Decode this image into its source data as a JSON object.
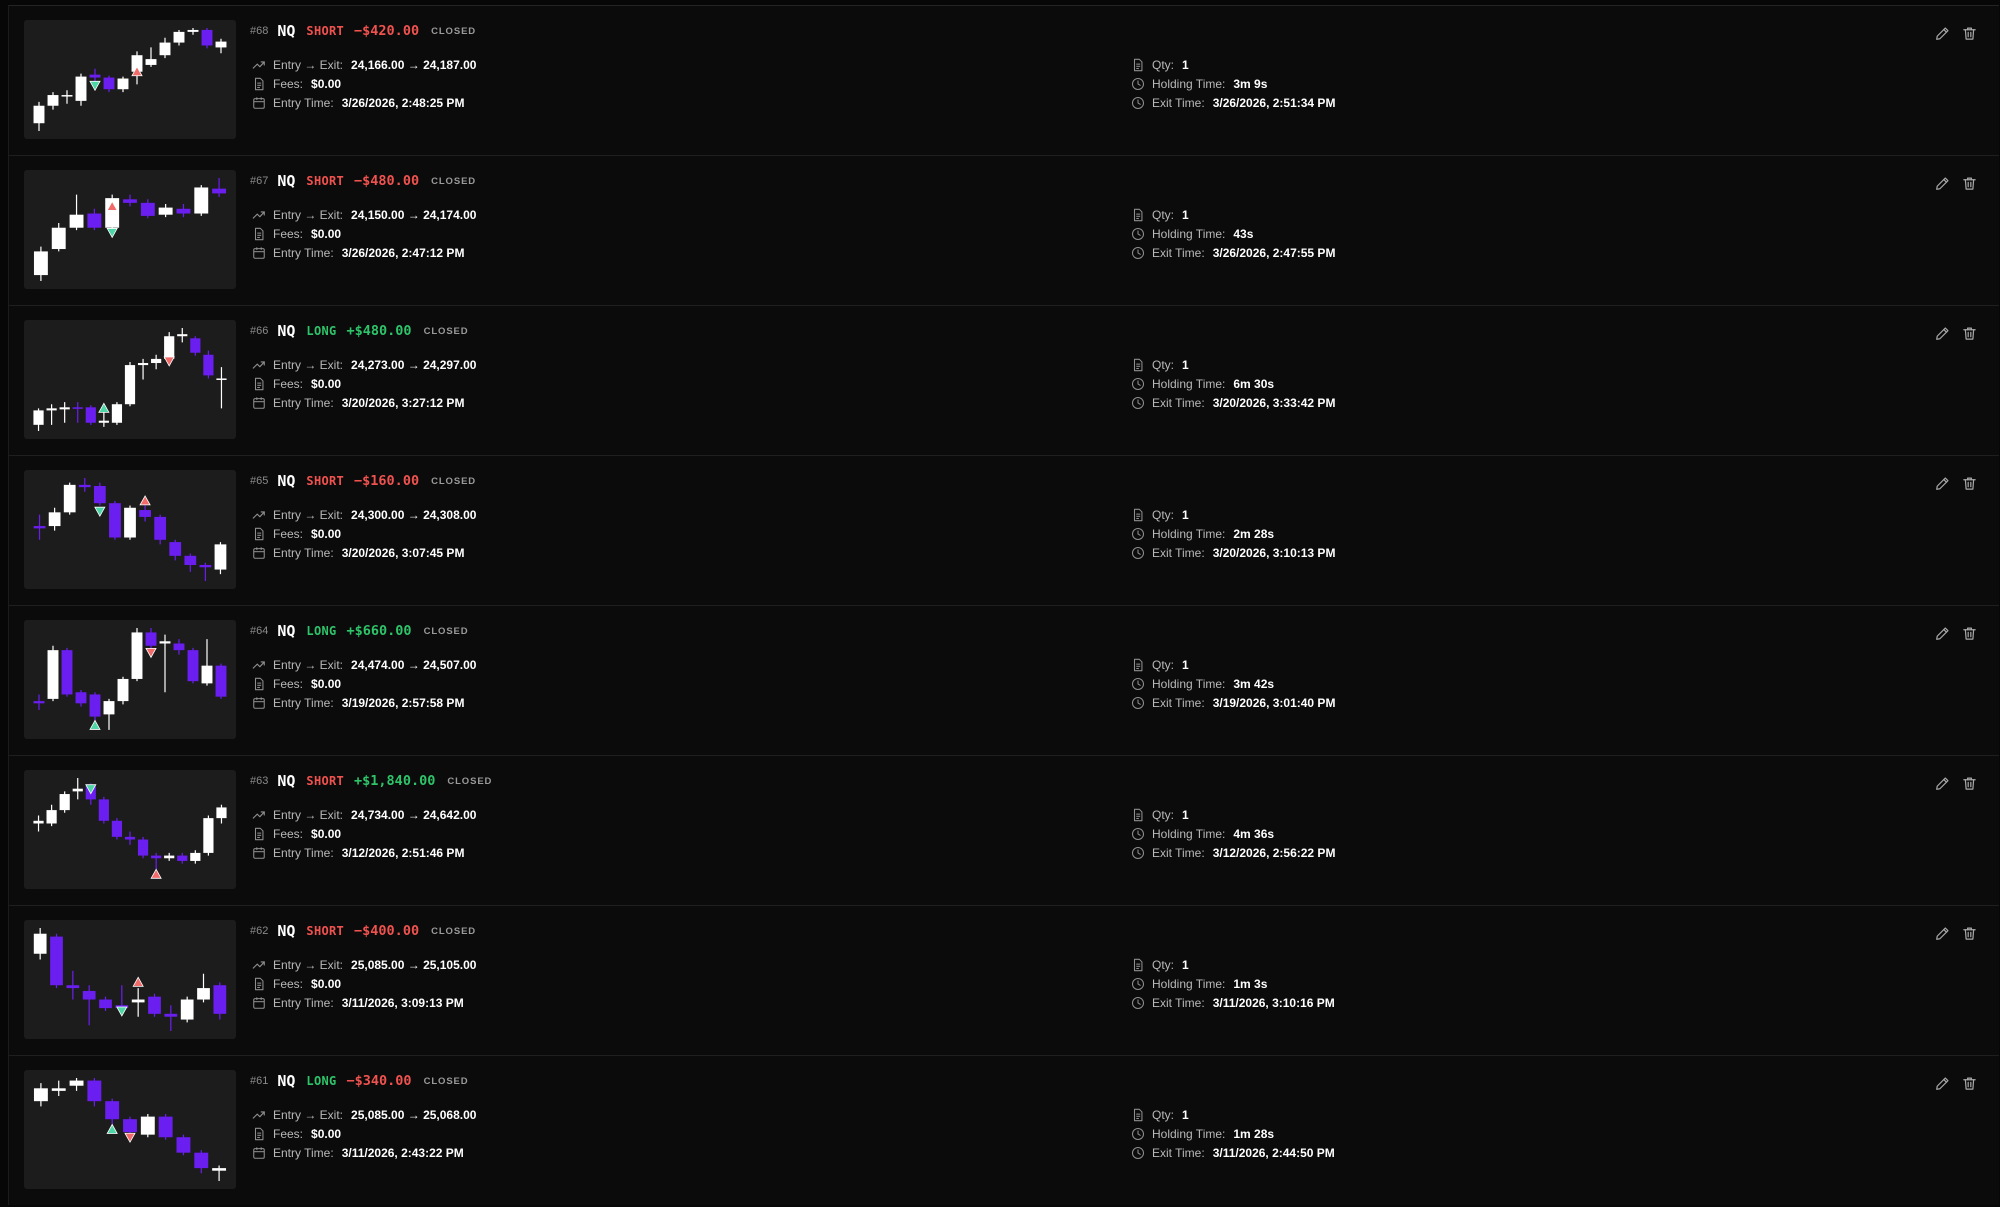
{
  "labels": {
    "entry_exit": "Entry → Exit:",
    "fees": "Fees:",
    "entry_time": "Entry Time:",
    "qty": "Qty:",
    "holding_time": "Holding Time:",
    "exit_time": "Exit Time:"
  },
  "colors": {
    "long": "#2ec46a",
    "short": "#f0524f",
    "profit": "#2ec46a",
    "loss": "#f0524f",
    "bear_candle": "#6b1ef0",
    "bull_candle": "#ffffff",
    "buy_marker": "#4fd6a6",
    "sell_marker": "#f26b6b"
  },
  "icons": {
    "entry_exit": "trending-up-icon",
    "fees": "receipt-icon",
    "entry_time": "calendar-icon",
    "qty": "document-icon",
    "holding_time": "clock-icon",
    "exit_time": "clock-icon",
    "edit": "pencil-icon",
    "delete": "trash-icon"
  },
  "trades": [
    {
      "id": "#68",
      "symbol": "NQ",
      "side": "SHORT",
      "pnl": "−$420.00",
      "pnl_sign": "loss",
      "status": "CLOSED",
      "entry_exit": "24,166.00 → 24,187.00",
      "fees": "$0.00",
      "entry_time": "3/26/2026, 2:48:25 PM",
      "qty": "1",
      "holding_time": "3m 9s",
      "exit_time": "3/26/2026, 2:51:34 PM",
      "chart": {
        "candles": [
          {
            "o": 1.2,
            "c": 3.0,
            "h": 3.4,
            "l": 0.4
          },
          {
            "o": 3.0,
            "c": 4.1,
            "h": 4.4,
            "l": 2.6
          },
          {
            "o": 4.0,
            "c": 4.1,
            "h": 4.6,
            "l": 3.2
          },
          {
            "o": 3.5,
            "c": 6.0,
            "h": 6.3,
            "l": 3.0
          },
          {
            "o": 6.2,
            "c": 5.9,
            "h": 6.8,
            "l": 5.3
          },
          {
            "o": 5.9,
            "c": 4.7,
            "h": 6.1,
            "l": 4.4
          },
          {
            "o": 4.7,
            "c": 5.8,
            "h": 6.0,
            "l": 4.4
          },
          {
            "o": 6.5,
            "c": 8.2,
            "h": 8.6,
            "l": 5.2
          },
          {
            "o": 7.2,
            "c": 7.8,
            "h": 9.0,
            "l": 7.0
          },
          {
            "o": 8.2,
            "c": 9.5,
            "h": 10.0,
            "l": 7.9
          },
          {
            "o": 9.5,
            "c": 10.6,
            "h": 10.8,
            "l": 9.2
          },
          {
            "o": 10.6,
            "c": 10.8,
            "h": 11.0,
            "l": 10.3
          },
          {
            "o": 10.8,
            "c": 9.2,
            "h": 11.0,
            "l": 8.9
          },
          {
            "o": 9.0,
            "c": 9.6,
            "h": 9.9,
            "l": 8.4
          }
        ],
        "markers": [
          {
            "i": 4,
            "dir": "down",
            "color": "buy",
            "v": 5.1
          },
          {
            "i": 7,
            "dir": "up",
            "color": "sell",
            "v": 6.5
          }
        ]
      }
    },
    {
      "id": "#67",
      "symbol": "NQ",
      "side": "SHORT",
      "pnl": "−$480.00",
      "pnl_sign": "loss",
      "status": "CLOSED",
      "entry_exit": "24,150.00 → 24,174.00",
      "fees": "$0.00",
      "entry_time": "3/26/2026, 2:47:12 PM",
      "qty": "1",
      "holding_time": "43s",
      "exit_time": "3/26/2026, 2:47:55 PM",
      "chart": {
        "candles": [
          {
            "o": 0.8,
            "c": 2.8,
            "h": 3.2,
            "l": 0.3
          },
          {
            "o": 3.0,
            "c": 4.8,
            "h": 5.2,
            "l": 2.8
          },
          {
            "o": 4.8,
            "c": 5.9,
            "h": 7.6,
            "l": 4.6
          },
          {
            "o": 6.0,
            "c": 4.8,
            "h": 6.4,
            "l": 4.6
          },
          {
            "o": 4.8,
            "c": 7.3,
            "h": 7.6,
            "l": 4.5
          },
          {
            "o": 7.2,
            "c": 6.9,
            "h": 7.6,
            "l": 6.6
          },
          {
            "o": 6.9,
            "c": 5.8,
            "h": 7.2,
            "l": 5.6
          },
          {
            "o": 5.9,
            "c": 6.5,
            "h": 6.8,
            "l": 5.7
          },
          {
            "o": 6.4,
            "c": 6.0,
            "h": 6.8,
            "l": 5.7
          },
          {
            "o": 6.0,
            "c": 8.2,
            "h": 8.4,
            "l": 5.8
          },
          {
            "o": 8.1,
            "c": 7.7,
            "h": 9.0,
            "l": 7.4
          }
        ],
        "markers": [
          {
            "i": 4,
            "dir": "up",
            "color": "sell",
            "v": 6.6
          },
          {
            "i": 4,
            "dir": "down",
            "color": "buy",
            "v": 4.4
          }
        ]
      }
    },
    {
      "id": "#66",
      "symbol": "NQ",
      "side": "LONG",
      "pnl": "+$480.00",
      "pnl_sign": "profit",
      "status": "CLOSED",
      "entry_exit": "24,273.00 → 24,297.00",
      "fees": "$0.00",
      "entry_time": "3/20/2026, 3:27:12 PM",
      "qty": "1",
      "holding_time": "6m 30s",
      "exit_time": "3/20/2026, 3:33:42 PM",
      "chart": {
        "candles": [
          {
            "o": 1.8,
            "c": 3.2,
            "h": 3.4,
            "l": 1.2
          },
          {
            "o": 3.2,
            "c": 3.4,
            "h": 3.8,
            "l": 1.8
          },
          {
            "o": 3.3,
            "c": 3.5,
            "h": 4.0,
            "l": 2.0
          },
          {
            "o": 3.5,
            "c": 3.4,
            "h": 4.0,
            "l": 2.0
          },
          {
            "o": 3.5,
            "c": 2.0,
            "h": 3.7,
            "l": 1.8
          },
          {
            "o": 2.0,
            "c": 2.2,
            "h": 3.0,
            "l": 1.6
          },
          {
            "o": 2.0,
            "c": 3.8,
            "h": 4.0,
            "l": 1.8
          },
          {
            "o": 3.8,
            "c": 7.6,
            "h": 7.9,
            "l": 3.6
          },
          {
            "o": 7.6,
            "c": 7.8,
            "h": 8.2,
            "l": 6.2
          },
          {
            "o": 7.8,
            "c": 8.2,
            "h": 8.6,
            "l": 7.2
          },
          {
            "o": 8.2,
            "c": 10.4,
            "h": 10.8,
            "l": 8.0
          },
          {
            "o": 10.4,
            "c": 10.6,
            "h": 11.2,
            "l": 9.8
          },
          {
            "o": 10.2,
            "c": 8.8,
            "h": 10.4,
            "l": 8.5
          },
          {
            "o": 8.6,
            "c": 6.6,
            "h": 9.0,
            "l": 6.3
          },
          {
            "o": 6.2,
            "c": 6.3,
            "h": 7.4,
            "l": 3.4
          }
        ],
        "markers": [
          {
            "i": 5,
            "dir": "up",
            "color": "buy",
            "v": 3.4
          },
          {
            "i": 10,
            "dir": "down",
            "color": "sell",
            "v": 8.0
          }
        ]
      }
    },
    {
      "id": "#65",
      "symbol": "NQ",
      "side": "SHORT",
      "pnl": "−$160.00",
      "pnl_sign": "loss",
      "status": "CLOSED",
      "entry_exit": "24,300.00 → 24,308.00",
      "fees": "$0.00",
      "entry_time": "3/20/2026, 3:07:45 PM",
      "qty": "1",
      "holding_time": "2m 28s",
      "exit_time": "3/20/2026, 3:10:13 PM",
      "chart": {
        "candles": [
          {
            "o": 6.2,
            "c": 6.0,
            "h": 7.2,
            "l": 5.0
          },
          {
            "o": 6.2,
            "c": 7.4,
            "h": 7.8,
            "l": 5.8
          },
          {
            "o": 7.4,
            "c": 9.8,
            "h": 10.0,
            "l": 7.2
          },
          {
            "o": 9.8,
            "c": 9.6,
            "h": 10.4,
            "l": 9.2
          },
          {
            "o": 9.7,
            "c": 8.2,
            "h": 10.0,
            "l": 8.0
          },
          {
            "o": 8.2,
            "c": 5.2,
            "h": 8.4,
            "l": 5.0
          },
          {
            "o": 5.2,
            "c": 7.8,
            "h": 8.0,
            "l": 5.0
          },
          {
            "o": 7.6,
            "c": 7.0,
            "h": 8.0,
            "l": 6.6
          },
          {
            "o": 7.0,
            "c": 5.0,
            "h": 7.2,
            "l": 4.6
          },
          {
            "o": 4.8,
            "c": 3.6,
            "h": 5.0,
            "l": 3.2
          },
          {
            "o": 3.6,
            "c": 2.8,
            "h": 3.8,
            "l": 2.2
          },
          {
            "o": 2.8,
            "c": 2.6,
            "h": 3.0,
            "l": 1.4
          },
          {
            "o": 2.4,
            "c": 4.6,
            "h": 4.8,
            "l": 2.0
          }
        ],
        "markers": [
          {
            "i": 4,
            "dir": "down",
            "color": "buy",
            "v": 7.5
          },
          {
            "i": 7,
            "dir": "up",
            "color": "sell",
            "v": 8.4
          }
        ]
      }
    },
    {
      "id": "#64",
      "symbol": "NQ",
      "side": "LONG",
      "pnl": "+$660.00",
      "pnl_sign": "profit",
      "status": "CLOSED",
      "entry_exit": "24,474.00 → 24,507.00",
      "fees": "$0.00",
      "entry_time": "3/19/2026, 2:57:58 PM",
      "qty": "1",
      "holding_time": "3m 42s",
      "exit_time": "3/19/2026, 3:01:40 PM",
      "chart": {
        "candles": [
          {
            "o": 3.8,
            "c": 3.6,
            "h": 4.4,
            "l": 3.0
          },
          {
            "o": 4.0,
            "c": 8.4,
            "h": 8.8,
            "l": 3.8
          },
          {
            "o": 8.4,
            "c": 4.4,
            "h": 8.6,
            "l": 4.2
          },
          {
            "o": 4.6,
            "c": 3.6,
            "h": 4.8,
            "l": 3.3
          },
          {
            "o": 4.4,
            "c": 2.4,
            "h": 4.6,
            "l": 2.0
          },
          {
            "o": 2.6,
            "c": 3.8,
            "h": 4.0,
            "l": 1.2
          },
          {
            "o": 3.8,
            "c": 5.8,
            "h": 6.0,
            "l": 3.5
          },
          {
            "o": 5.8,
            "c": 10.0,
            "h": 10.4,
            "l": 5.6
          },
          {
            "o": 10.0,
            "c": 8.8,
            "h": 10.4,
            "l": 8.4
          },
          {
            "o": 9.0,
            "c": 9.2,
            "h": 9.8,
            "l": 4.6
          },
          {
            "o": 9.0,
            "c": 8.4,
            "h": 9.4,
            "l": 8.0
          },
          {
            "o": 8.4,
            "c": 5.6,
            "h": 8.6,
            "l": 5.4
          },
          {
            "o": 5.4,
            "c": 7.0,
            "h": 9.4,
            "l": 5.2
          },
          {
            "o": 7.0,
            "c": 4.2,
            "h": 7.2,
            "l": 4.0
          }
        ],
        "markers": [
          {
            "i": 4,
            "dir": "up",
            "color": "buy",
            "v": 1.6
          },
          {
            "i": 8,
            "dir": "down",
            "color": "sell",
            "v": 8.2
          }
        ]
      }
    },
    {
      "id": "#63",
      "symbol": "NQ",
      "side": "SHORT",
      "pnl": "+$1,840.00",
      "pnl_sign": "profit",
      "status": "CLOSED",
      "entry_exit": "24,734.00 → 24,642.00",
      "fees": "$0.00",
      "entry_time": "3/12/2026, 2:51:46 PM",
      "qty": "1",
      "holding_time": "4m 36s",
      "exit_time": "3/12/2026, 2:56:22 PM",
      "chart": {
        "candles": [
          {
            "o": 6.0,
            "c": 6.2,
            "h": 6.6,
            "l": 5.4
          },
          {
            "o": 6.0,
            "c": 7.0,
            "h": 7.4,
            "l": 5.8
          },
          {
            "o": 7.0,
            "c": 8.2,
            "h": 8.4,
            "l": 6.8
          },
          {
            "o": 8.4,
            "c": 8.6,
            "h": 9.4,
            "l": 7.8
          },
          {
            "o": 8.8,
            "c": 7.8,
            "h": 9.0,
            "l": 7.4
          },
          {
            "o": 7.8,
            "c": 6.2,
            "h": 8.0,
            "l": 6.0
          },
          {
            "o": 6.2,
            "c": 5.0,
            "h": 6.4,
            "l": 4.8
          },
          {
            "o": 5.0,
            "c": 4.8,
            "h": 5.4,
            "l": 4.4
          },
          {
            "o": 4.8,
            "c": 3.6,
            "h": 5.0,
            "l": 3.4
          },
          {
            "o": 3.6,
            "c": 3.4,
            "h": 3.8,
            "l": 2.6
          },
          {
            "o": 3.4,
            "c": 3.6,
            "h": 3.8,
            "l": 3.2
          },
          {
            "o": 3.6,
            "c": 3.2,
            "h": 3.8,
            "l": 3.0
          },
          {
            "o": 3.2,
            "c": 3.8,
            "h": 4.0,
            "l": 3.0
          },
          {
            "o": 3.8,
            "c": 6.4,
            "h": 6.6,
            "l": 3.6
          },
          {
            "o": 6.4,
            "c": 7.2,
            "h": 7.4,
            "l": 6.0
          }
        ],
        "markers": [
          {
            "i": 4,
            "dir": "down",
            "color": "buy",
            "v": 8.6
          },
          {
            "i": 9,
            "dir": "up",
            "color": "sell",
            "v": 2.2
          }
        ]
      }
    },
    {
      "id": "#62",
      "symbol": "NQ",
      "side": "SHORT",
      "pnl": "−$400.00",
      "pnl_sign": "loss",
      "status": "CLOSED",
      "entry_exit": "25,085.00 → 25,105.00",
      "fees": "$0.00",
      "entry_time": "3/11/2026, 3:09:13 PM",
      "qty": "1",
      "holding_time": "1m 3s",
      "exit_time": "3/11/2026, 3:10:16 PM",
      "chart": {
        "candles": [
          {
            "o": 7.8,
            "c": 9.2,
            "h": 9.6,
            "l": 7.4
          },
          {
            "o": 9.0,
            "c": 5.6,
            "h": 9.2,
            "l": 5.4
          },
          {
            "o": 5.6,
            "c": 5.4,
            "h": 6.6,
            "l": 4.6
          },
          {
            "o": 5.2,
            "c": 4.6,
            "h": 5.6,
            "l": 2.8
          },
          {
            "o": 4.6,
            "c": 4.0,
            "h": 4.8,
            "l": 3.8
          },
          {
            "o": 4.2,
            "c": 4.0,
            "h": 5.6,
            "l": 3.6
          },
          {
            "o": 4.4,
            "c": 4.6,
            "h": 5.4,
            "l": 3.4
          },
          {
            "o": 4.8,
            "c": 3.6,
            "h": 5.0,
            "l": 3.4
          },
          {
            "o": 3.6,
            "c": 3.4,
            "h": 4.2,
            "l": 2.4
          },
          {
            "o": 3.2,
            "c": 4.6,
            "h": 4.8,
            "l": 3.0
          },
          {
            "o": 4.6,
            "c": 5.4,
            "h": 6.4,
            "l": 4.4
          },
          {
            "o": 5.6,
            "c": 3.6,
            "h": 5.8,
            "l": 3.2
          }
        ],
        "markers": [
          {
            "i": 5,
            "dir": "down",
            "color": "buy",
            "v": 3.8
          },
          {
            "i": 6,
            "dir": "up",
            "color": "sell",
            "v": 5.8
          }
        ]
      }
    },
    {
      "id": "#61",
      "symbol": "NQ",
      "side": "LONG",
      "pnl": "−$340.00",
      "pnl_sign": "loss",
      "status": "CLOSED",
      "entry_exit": "25,085.00 → 25,068.00",
      "fees": "$0.00",
      "entry_time": "3/11/2026, 2:43:22 PM",
      "qty": "1",
      "holding_time": "1m 28s",
      "exit_time": "3/11/2026, 2:44:50 PM",
      "chart": {
        "candles": [
          {
            "o": 8.0,
            "c": 9.0,
            "h": 9.4,
            "l": 7.6
          },
          {
            "o": 8.8,
            "c": 9.0,
            "h": 9.6,
            "l": 8.4
          },
          {
            "o": 9.2,
            "c": 9.6,
            "h": 9.8,
            "l": 8.8
          },
          {
            "o": 9.6,
            "c": 8.0,
            "h": 9.8,
            "l": 7.6
          },
          {
            "o": 8.0,
            "c": 6.6,
            "h": 8.2,
            "l": 6.2
          },
          {
            "o": 6.6,
            "c": 5.6,
            "h": 6.8,
            "l": 5.4
          },
          {
            "o": 5.4,
            "c": 6.8,
            "h": 7.0,
            "l": 5.2
          },
          {
            "o": 6.8,
            "c": 5.2,
            "h": 7.0,
            "l": 5.0
          },
          {
            "o": 5.2,
            "c": 4.0,
            "h": 5.4,
            "l": 3.8
          },
          {
            "o": 4.0,
            "c": 2.8,
            "h": 4.2,
            "l": 2.4
          },
          {
            "o": 2.6,
            "c": 2.8,
            "h": 3.0,
            "l": 1.8
          }
        ],
        "markers": [
          {
            "i": 4,
            "dir": "up",
            "color": "buy",
            "v": 5.8
          },
          {
            "i": 5,
            "dir": "down",
            "color": "sell",
            "v": 5.2
          }
        ]
      }
    }
  ]
}
